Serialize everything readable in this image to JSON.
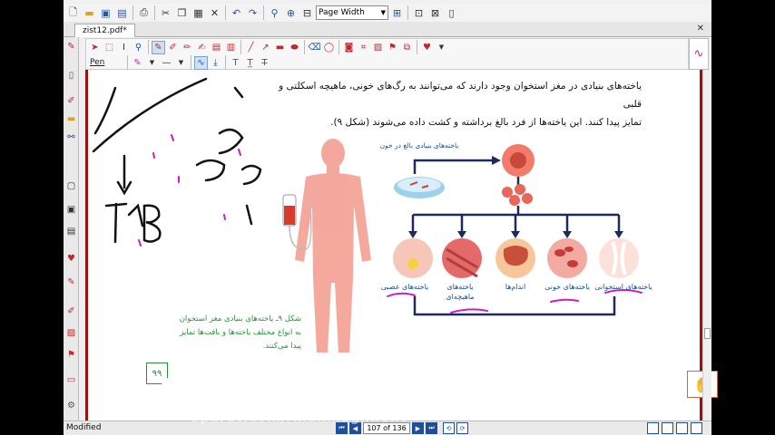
{
  "toolbar": {
    "zoom_value": "Page Width"
  },
  "tabs": [
    {
      "label": "zist12.pdf*"
    }
  ],
  "ink_toolbar": {
    "tool_label": "Pen"
  },
  "document": {
    "paragraph_line1": "یاخته‌های بنیادی در مغز استخوان وجود دارند که می‌توانند به رگ‌های خونی، ماهیچه اسکلتی و قلبی",
    "paragraph_line2": "تمایز پیدا کنند. این یاخته‌ها از فرد بالغ برداشته و کشت داده می‌شوند (شکل ۹).",
    "figure_title": "یاخته‌های بنیادی بالغ در خون",
    "figure_labels": [
      "یاخته‌های عصبی",
      "یاخته‌های ماهیچه‌ای",
      "اندام‌ها",
      "یاخته‌های خونی",
      "یاخته‌های استخوانی"
    ],
    "caption_line1": "شکل ۹ـ یاخته‌های بنیادی مغز استخوان",
    "caption_line2": "به انواع مختلف یاخته‌ها و بافت‌ها تمایز",
    "caption_line3": "پیدا می‌کنند.",
    "page_badge": "۹۹",
    "handwriting": [
      "T+B",
      "تعیین",
      "جبولا حتر",
      "پیدات"
    ]
  },
  "statusbar": {
    "status": "Modified",
    "page_indicator": "107 of 136"
  },
  "watermark": "aparat.com/Ahanmaghnent",
  "colors": {
    "page_border": "#a01010",
    "ink_magenta": "#c81ec8",
    "caption_green": "#2a8f3a",
    "label_blue": "#1a4fa0",
    "arrow_navy": "#1f2a5c"
  }
}
